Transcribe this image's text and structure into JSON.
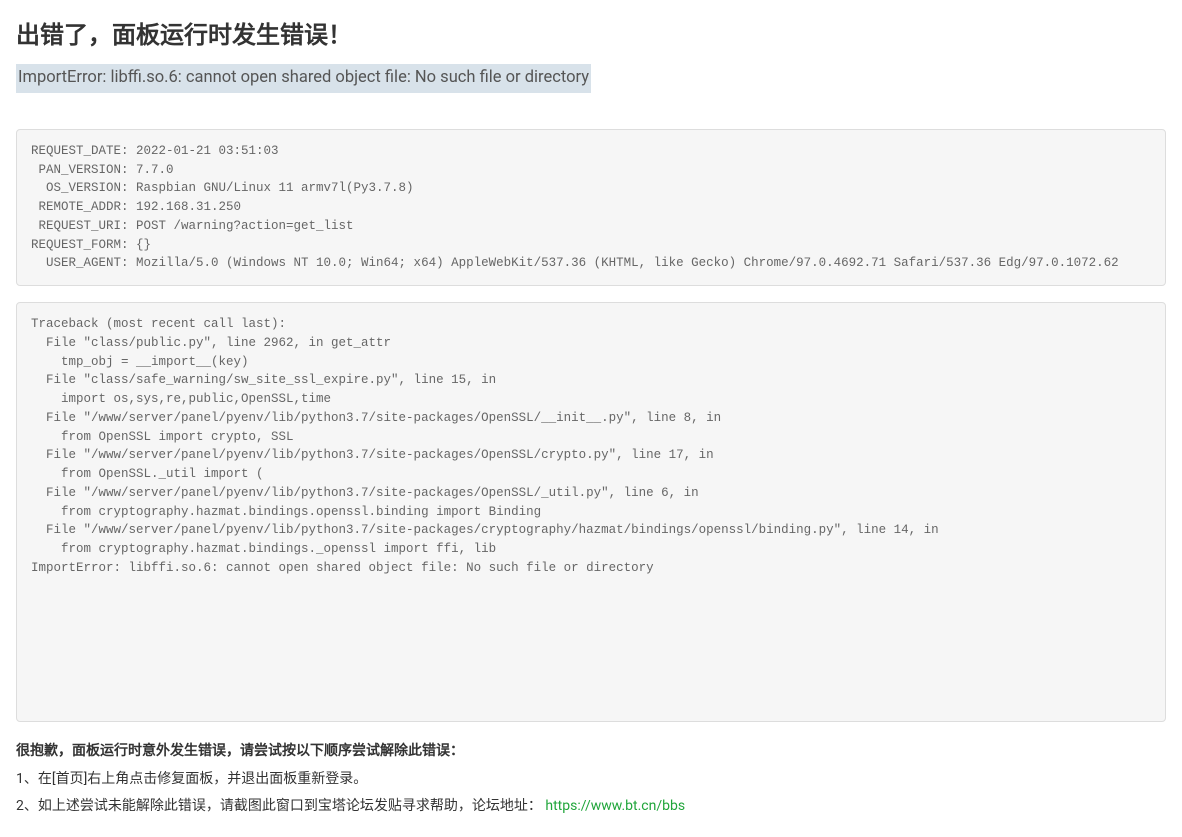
{
  "title": "出错了，面板运行时发生错误！",
  "subtitle": "ImportError: libffi.so.6: cannot open shared object file: No such file or directory",
  "request_block": "REQUEST_DATE: 2022-01-21 03:51:03\n PAN_VERSION: 7.7.0\n  OS_VERSION: Raspbian GNU/Linux 11 armv7l(Py3.7.8)\n REMOTE_ADDR: 192.168.31.250\n REQUEST_URI: POST /warning?action=get_list\nREQUEST_FORM: {}\n  USER_AGENT: Mozilla/5.0 (Windows NT 10.0; Win64; x64) AppleWebKit/537.36 (KHTML, like Gecko) Chrome/97.0.4692.71 Safari/537.36 Edg/97.0.1072.62",
  "traceback_block": "Traceback (most recent call last):\n  File \"class/public.py\", line 2962, in get_attr\n    tmp_obj = __import__(key)\n  File \"class/safe_warning/sw_site_ssl_expire.py\", line 15, in \n    import os,sys,re,public,OpenSSL,time\n  File \"/www/server/panel/pyenv/lib/python3.7/site-packages/OpenSSL/__init__.py\", line 8, in \n    from OpenSSL import crypto, SSL\n  File \"/www/server/panel/pyenv/lib/python3.7/site-packages/OpenSSL/crypto.py\", line 17, in \n    from OpenSSL._util import (\n  File \"/www/server/panel/pyenv/lib/python3.7/site-packages/OpenSSL/_util.py\", line 6, in \n    from cryptography.hazmat.bindings.openssl.binding import Binding\n  File \"/www/server/panel/pyenv/lib/python3.7/site-packages/cryptography/hazmat/bindings/openssl/binding.py\", line 14, in \n    from cryptography.hazmat.bindings._openssl import ffi, lib\nImportError: libffi.so.6: cannot open shared object file: No such file or directory",
  "footer": {
    "heading": "很抱歉，面板运行时意外发生错误，请尝试按以下顺序尝试解除此错误：",
    "item1": "1、在[首页]右上角点击修复面板，并退出面板重新登录。",
    "item2_prefix": "2、如上述尝试未能解除此错误，请截图此窗口到宝塔论坛发贴寻求帮助，论坛地址：",
    "item2_link": "https://www.bt.cn/bbs"
  }
}
